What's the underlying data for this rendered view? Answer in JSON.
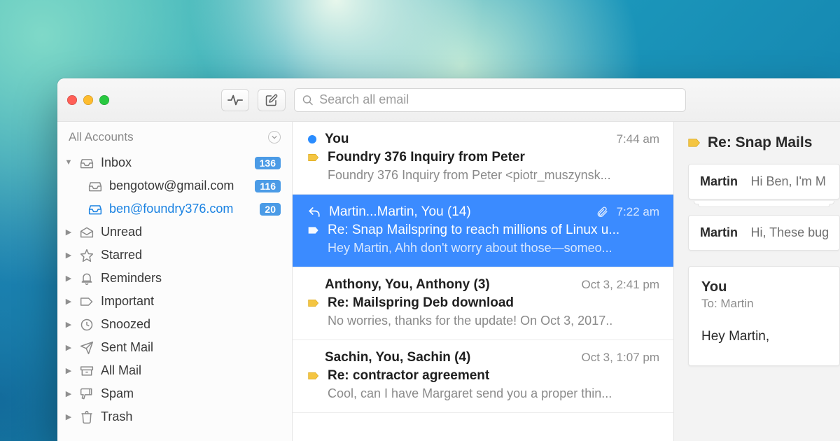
{
  "toolbar": {
    "search_placeholder": "Search all email"
  },
  "sidebar": {
    "header": "All Accounts",
    "inbox": {
      "label": "Inbox",
      "count": "136"
    },
    "accounts": [
      {
        "label": "bengotow@gmail.com",
        "count": "116"
      },
      {
        "label": "ben@foundry376.com",
        "count": "20",
        "active": true
      }
    ],
    "folders": [
      {
        "label": "Unread"
      },
      {
        "label": "Starred"
      },
      {
        "label": "Reminders"
      },
      {
        "label": "Important"
      },
      {
        "label": "Snoozed"
      },
      {
        "label": "Sent Mail"
      },
      {
        "label": "All Mail"
      },
      {
        "label": "Spam"
      },
      {
        "label": "Trash"
      }
    ]
  },
  "messages": [
    {
      "from": "You",
      "time": "7:44 am",
      "subject": "Foundry 376 Inquiry from Peter",
      "snippet": "Foundry 376 Inquiry from Peter <piotr_muszynsk...",
      "unread": true,
      "tag": true
    },
    {
      "from": "Martin...Martin, You (14)",
      "time": "7:22 am",
      "subject": "Re: Snap Mailspring to reach millions of Linux u...",
      "snippet": "Hey Martin, Ahh don't worry about those—someo...",
      "selected": true,
      "reply": true,
      "attachment": true,
      "tag": true
    },
    {
      "from": "Anthony, You, Anthony (3)",
      "time": "Oct 3, 2:41 pm",
      "subject": "Re: Mailspring Deb download",
      "snippet": "No worries, thanks for the update! On Oct 3, 2017..",
      "tag": true
    },
    {
      "from": "Sachin, You, Sachin (4)",
      "time": "Oct 3, 1:07 pm",
      "subject": "Re: contractor agreement",
      "snippet": "Cool, can I have Margaret send you a proper thin...",
      "tag": true
    }
  ],
  "reader": {
    "subject": "Re: Snap Mails",
    "threads": [
      {
        "who": "Martin",
        "text": "Hi Ben, I'm M"
      },
      {
        "who": "Martin",
        "text": "Hi, These bug"
      }
    ],
    "compose": {
      "who": "You",
      "to_label": "To: Martin",
      "body": "Hey Martin,"
    }
  }
}
